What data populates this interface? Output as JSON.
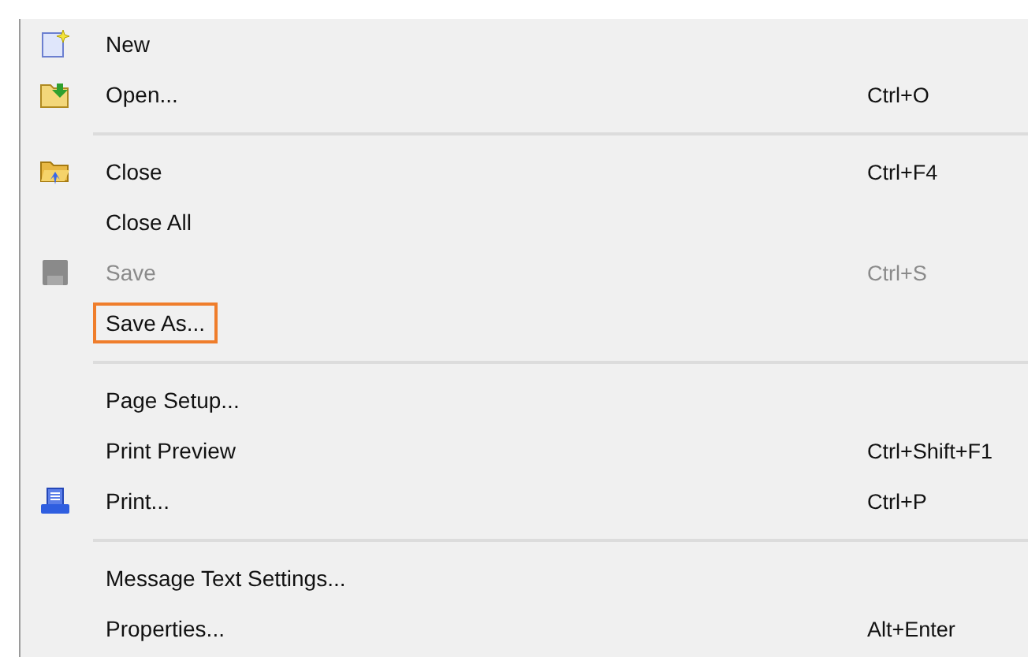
{
  "menu": {
    "items": [
      {
        "kind": "item",
        "label": "New",
        "disabled": false,
        "selected": false
      },
      {
        "kind": "item",
        "label": "Open...",
        "shortcut": "Ctrl+O",
        "disabled": false,
        "selected": false
      },
      {
        "kind": "separator"
      },
      {
        "kind": "item",
        "label": "Close",
        "shortcut": "Ctrl+F4",
        "disabled": false,
        "selected": false
      },
      {
        "kind": "item",
        "label": "Close All",
        "disabled": false,
        "selected": false
      },
      {
        "kind": "item",
        "label": "Save",
        "shortcut": "Ctrl+S",
        "disabled": true,
        "selected": false
      },
      {
        "kind": "item",
        "label": "Save As...",
        "disabled": false,
        "selected": true
      },
      {
        "kind": "separator"
      },
      {
        "kind": "item",
        "label": "Page Setup...",
        "disabled": false,
        "selected": false
      },
      {
        "kind": "item",
        "label": "Print Preview",
        "shortcut": "Ctrl+Shift+F1",
        "disabled": false,
        "selected": false
      },
      {
        "kind": "item",
        "label": "Print...",
        "shortcut": "Ctrl+P",
        "disabled": false,
        "selected": false
      },
      {
        "kind": "separator"
      },
      {
        "kind": "item",
        "label": "Message Text Settings...",
        "disabled": false,
        "selected": false
      },
      {
        "kind": "item",
        "label": "Properties...",
        "shortcut": "Alt+Enter",
        "disabled": false,
        "selected": false
      }
    ]
  }
}
